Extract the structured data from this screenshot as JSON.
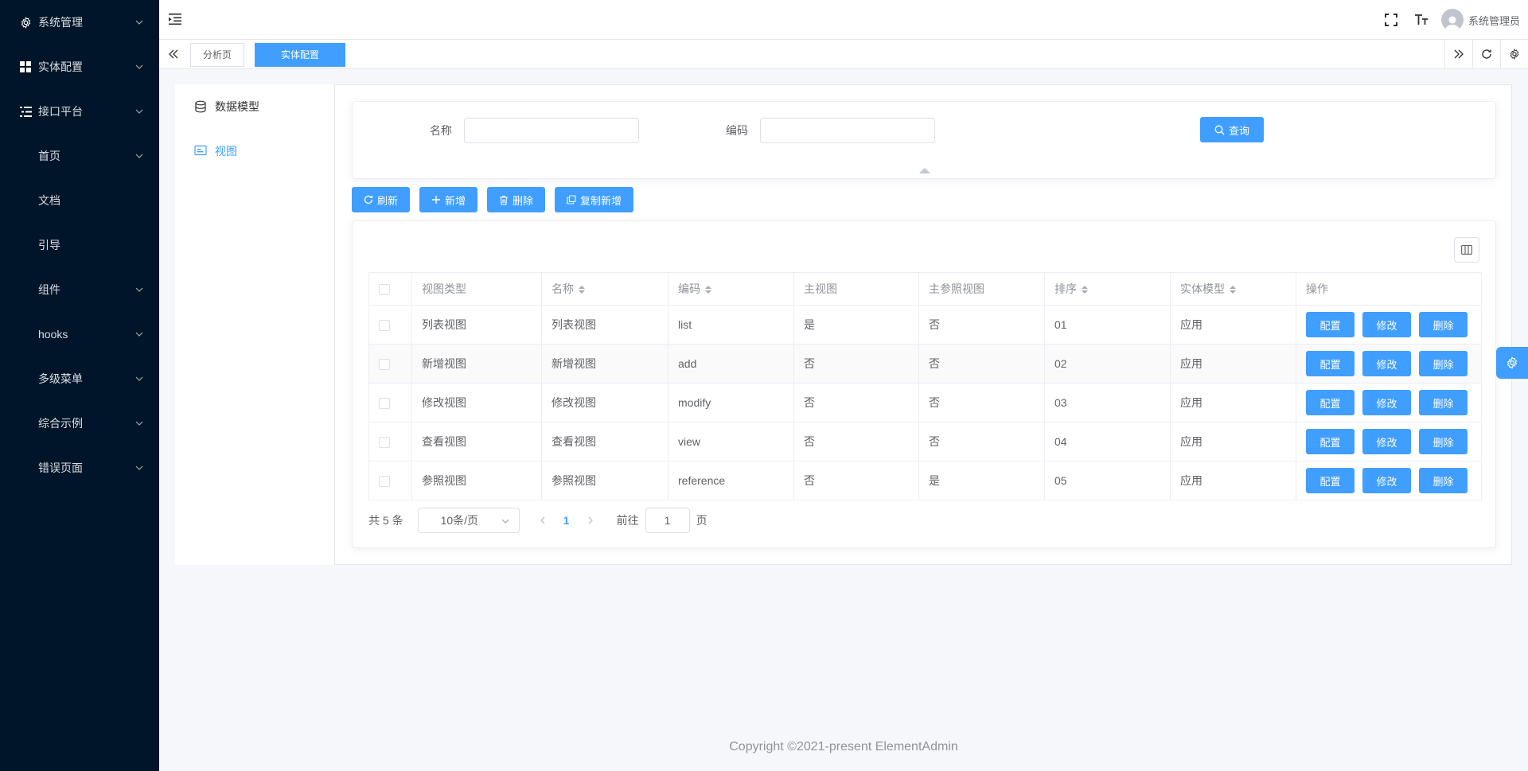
{
  "sidebar": {
    "items": [
      {
        "label": "系统管理",
        "icon": "gear-icon",
        "has_children": true
      },
      {
        "label": "实体配置",
        "icon": "grid-icon",
        "has_children": true
      },
      {
        "label": "接口平台",
        "icon": "list-icon",
        "has_children": true
      },
      {
        "label": "首页",
        "has_children": true
      },
      {
        "label": "文档",
        "has_children": false
      },
      {
        "label": "引导",
        "has_children": false
      },
      {
        "label": "组件",
        "has_children": true
      },
      {
        "label": "hooks",
        "has_children": true
      },
      {
        "label": "多级菜单",
        "has_children": true
      },
      {
        "label": "综合示例",
        "has_children": true
      },
      {
        "label": "错误页面",
        "has_children": true
      }
    ]
  },
  "header": {
    "user_name": "系统管理员"
  },
  "tags": {
    "items": [
      {
        "label": "分析页",
        "active": false
      },
      {
        "label": "实体配置",
        "active": true
      }
    ]
  },
  "tree": {
    "items": [
      {
        "label": "数据模型",
        "icon": "database-icon",
        "active": false
      },
      {
        "label": "视图",
        "icon": "view-icon",
        "active": true
      }
    ]
  },
  "search": {
    "name_label": "名称",
    "name_value": "",
    "code_label": "编码",
    "code_value": "",
    "query_button": "查询"
  },
  "toolbar": {
    "refresh": "刷新",
    "add": "新增",
    "delete": "删除",
    "copy_add": "复制新增"
  },
  "table": {
    "columns": [
      "视图类型",
      "名称",
      "编码",
      "主视图",
      "主参照视图",
      "排序",
      "实体模型",
      "操作"
    ],
    "rows": [
      {
        "type": "列表视图",
        "name": "列表视图",
        "code": "list",
        "main": "是",
        "main_ref": "否",
        "order": "01",
        "entity": "应用"
      },
      {
        "type": "新增视图",
        "name": "新增视图",
        "code": "add",
        "main": "否",
        "main_ref": "否",
        "order": "02",
        "entity": "应用"
      },
      {
        "type": "修改视图",
        "name": "修改视图",
        "code": "modify",
        "main": "否",
        "main_ref": "否",
        "order": "03",
        "entity": "应用"
      },
      {
        "type": "查看视图",
        "name": "查看视图",
        "code": "view",
        "main": "否",
        "main_ref": "否",
        "order": "04",
        "entity": "应用"
      },
      {
        "type": "参照视图",
        "name": "参照视图",
        "code": "reference",
        "main": "否",
        "main_ref": "是",
        "order": "05",
        "entity": "应用"
      }
    ],
    "actions": {
      "config": "配置",
      "edit": "修改",
      "delete": "删除"
    }
  },
  "pagination": {
    "total": "共 5 条",
    "page_size": "10条/页",
    "current_page": "1",
    "goto_label": "前往",
    "goto_value": "1",
    "page_suffix": "页"
  },
  "footer": {
    "copyright": "Copyright ©2021-present ElementAdmin"
  },
  "colors": {
    "sidebar_bg": "#001529",
    "primary": "#409eff"
  }
}
